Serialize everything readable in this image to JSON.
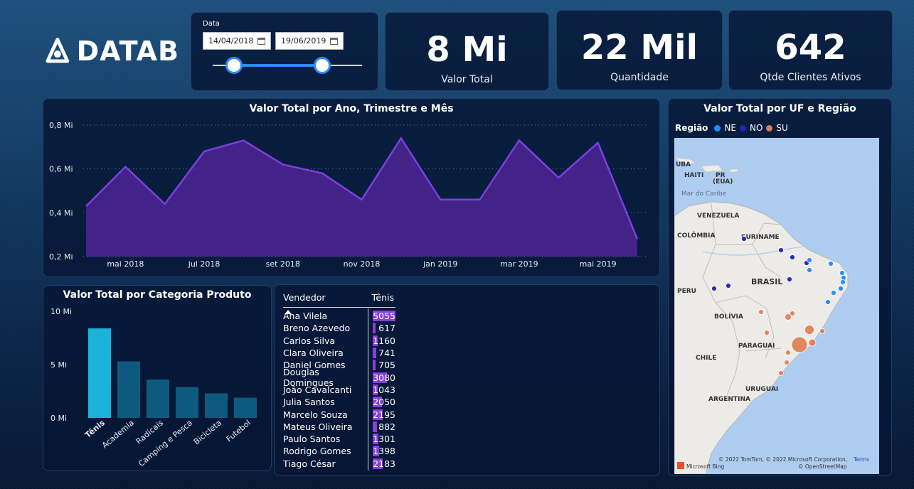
{
  "brand": {
    "logo_text": "DATAB"
  },
  "date_slicer": {
    "title": "Data",
    "start_date": "14/04/2018",
    "end_date": "19/06/2019"
  },
  "kpis": [
    {
      "value": "8 Mi",
      "label": "Valor Total"
    },
    {
      "value": "22 Mil",
      "label": "Quantidade"
    },
    {
      "value": "642",
      "label": "Qtde Clientes Ativos"
    }
  ],
  "area_chart": {
    "title": "Valor Total por Ano, Trimestre e Mês",
    "y_ticks": [
      "0,8 Mi",
      "0,6 Mi",
      "0,4 Mi",
      "0,2 Mi"
    ],
    "x_ticks": [
      "mai 2018",
      "jul 2018",
      "set 2018",
      "nov 2018",
      "jan 2019",
      "mar 2019",
      "mai 2019"
    ],
    "color": "#7b3fe0"
  },
  "bar_chart": {
    "title": "Valor Total por Categoria Produto",
    "y_ticks": [
      "10 Mi",
      "5 Mi",
      "0 Mi"
    ],
    "highlight_color": "#1ab2d8",
    "base_color": "#0e5a7e"
  },
  "table": {
    "header": {
      "col1": "Vendedor",
      "col2": "Tênis"
    },
    "bar_color": "#8b3fd9",
    "rows": [
      {
        "name": "Ana Vilela",
        "value": "5055"
      },
      {
        "name": "Breno Azevedo",
        "value": "617"
      },
      {
        "name": "Carlos Silva",
        "value": "1160"
      },
      {
        "name": "Clara Oliveira",
        "value": "741"
      },
      {
        "name": "Daniel Gomes",
        "value": "705"
      },
      {
        "name": "Douglas Domingues",
        "value": "3080"
      },
      {
        "name": "João Cavalcanti",
        "value": "1043"
      },
      {
        "name": "Julia Santos",
        "value": "2050"
      },
      {
        "name": "Marcelo Souza",
        "value": "2195"
      },
      {
        "name": "Mateus Oliveira",
        "value": "882"
      },
      {
        "name": "Paulo Santos",
        "value": "1301"
      },
      {
        "name": "Rodrigo Gomes",
        "value": "1398"
      },
      {
        "name": "Tiago César",
        "value": "2183"
      }
    ]
  },
  "map": {
    "title": "Valor Total por UF e Região",
    "legend_title": "Região",
    "legend": [
      {
        "label": "NE",
        "color": "#1e90ff"
      },
      {
        "label": "NO",
        "color": "#2222b8"
      },
      {
        "label": "SU",
        "color": "#e07b4f"
      }
    ],
    "labels": {
      "cuba": "UBA",
      "haiti": "HAITI",
      "pr": "PR",
      "eua": "(EUA)",
      "caribe": "Mar do Caribe",
      "venezuela": "VENEZUELA",
      "colombia": "COLÔMBIA",
      "suriname": "SURINAME",
      "brasil": "BRASIL",
      "peru": "PERU",
      "bolivia": "BOLÍVIA",
      "paraguai": "PARAGUAI",
      "chile": "CHILE",
      "uruguai": "URUGUAI",
      "argentina": "ARGENTINA"
    },
    "attribution": "© 2022 TomTom, © 2022 Microsoft Corporation,",
    "terms": "Terms",
    "osm": "© OpenStreetMap",
    "bing": "Microsoft Bing"
  },
  "chart_data": [
    {
      "type": "area",
      "title": "Valor Total por Ano, Trimestre e Mês",
      "x": [
        "abr 2018",
        "mai 2018",
        "jun 2018",
        "jul 2018",
        "ago 2018",
        "set 2018",
        "out 2018",
        "nov 2018",
        "dez 2018",
        "jan 2019",
        "fev 2019",
        "mar 2019",
        "abr 2019",
        "mai 2019",
        "jun 2019"
      ],
      "series": [
        {
          "values": [
            0.43,
            0.61,
            0.44,
            0.68,
            0.73,
            0.62,
            0.58,
            0.46,
            0.74,
            0.46,
            0.46,
            0.73,
            0.56,
            0.72,
            0.28
          ]
        }
      ],
      "ylim": [
        0.2,
        0.8
      ],
      "yunit": "Mi",
      "grid": true
    },
    {
      "type": "bar",
      "title": "Valor Total por Categoria Produto",
      "categories": [
        "Tênis",
        "Academia",
        "Radicais",
        "Camping e Pesca",
        "Bicicleta",
        "Futebol"
      ],
      "values": [
        8.4,
        5.3,
        3.6,
        2.9,
        2.3,
        1.9
      ],
      "ylim": [
        0,
        10
      ],
      "yunit": "Mi",
      "selected": "Tênis"
    }
  ]
}
